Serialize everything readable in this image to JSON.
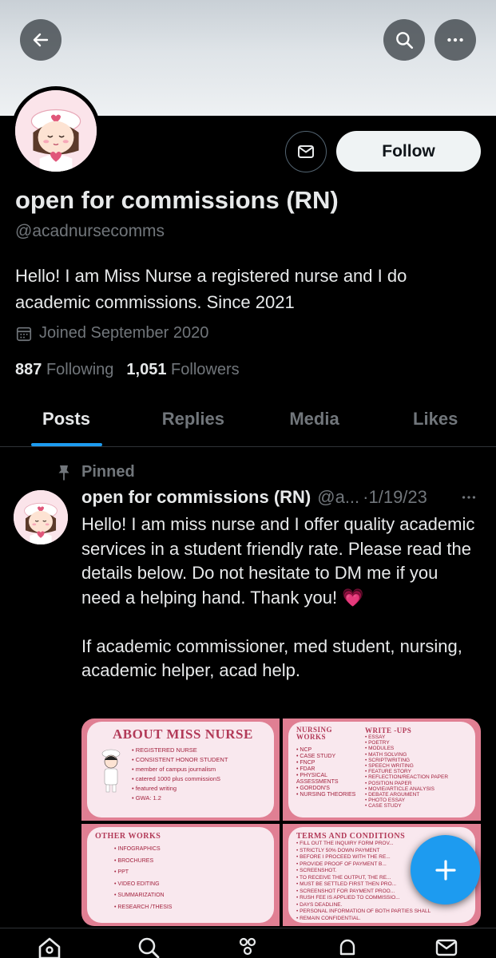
{
  "profile": {
    "display_name": "open for commissions (RN)",
    "handle": "@acadnursecomms",
    "bio": "Hello! I am Miss Nurse a registered nurse and I do academic commissions. Since 2021",
    "joined": "Joined September 2020",
    "following_count": "887",
    "following_label": "Following",
    "followers_count": "1,051",
    "followers_label": "Followers",
    "follow_label": "Follow"
  },
  "tabs": [
    {
      "label": "Posts",
      "active": true
    },
    {
      "label": "Replies",
      "active": false
    },
    {
      "label": "Media",
      "active": false
    },
    {
      "label": "Likes",
      "active": false
    }
  ],
  "pinned_post": {
    "pinned_label": "Pinned",
    "author": "open for commissions (RN)",
    "handle": "@a...",
    "date": "·1/19/23",
    "text": "Hello! I am miss nurse and I offer quality academic services in a student friendly rate. Please read the details below. Do not hesitate to DM me if you need a helping hand. Thank you! 💗\n\nIf academic commissioner, med student, nursing, academic helper, acad help.",
    "media": {
      "about": {
        "title": "ABOUT MISS NURSE",
        "items": [
          "REGISTERED NURSE",
          "CONSISTENT HONOR STUDENT",
          "member of campus journalism",
          "catered 1000 plus commissionS",
          "featured writing",
          "GWA: 1.2"
        ]
      },
      "nursing": {
        "title": "NURSING WORKS",
        "items": [
          "NCP",
          "CASE STUDY",
          "FNCP",
          "FDAR",
          "PHYSICAL ASSESSMENTS",
          "GORDON'S",
          "NURSING THEORIES"
        ]
      },
      "writeups": {
        "title": "WRITE -UPS",
        "items": [
          "ESSAY",
          "POETRY",
          "MODULES",
          "MATH SOLVING",
          "SCRIPTWRITING",
          "SPEECH WRITING",
          "FEATURE STORY",
          "REFLECTION/REACTION PAPER",
          "POSITION PAPER",
          "MOVIE/ARTICLE ANALYSIS",
          "DEBATE ARGUMENT",
          "PHOTO ESSAY",
          "CASE STUDY"
        ]
      },
      "other": {
        "title": "OTHER WORKS",
        "items": [
          "INFOGRAPHICS",
          "BROCHURES",
          "PPT",
          "VIDEO EDITING",
          "SUMMARIZATION",
          "RESEARCH /THESIS"
        ]
      },
      "terms": {
        "title": "TERMS AND CONDITIONS",
        "items": [
          "FILL OUT THE INQUIRY FORM PROV...",
          "STRICTLY 50% DOWN PAYMENT",
          "BEFORE I PROCEED WITH THE RE...",
          "PROVIDE PROOF OF PAYMENT B...",
          "SCREENSHOT.",
          "TO RECEIVE THE OUTPUT, THE RE...",
          "MUST BE SETTLED FIRST THEN PRO...",
          "SCREENSHOT FOR PAYMENT PROO...",
          "RUSH FEE IS APPLIED TO COMMISSIO...",
          "DAYS DEADLINE.",
          "PERSONAL INFORMATION OF BOTH PARTIES SHALL",
          "REMAIN CONFIDENTIAL."
        ]
      }
    }
  },
  "icons": {
    "back": "arrow-left-icon",
    "search": "search-icon",
    "more": "more-icon",
    "message": "envelope-icon",
    "calendar": "calendar-icon",
    "pin": "pin-icon",
    "compose": "plus-icon"
  },
  "colors": {
    "accent": "#1d9bf0",
    "background": "#000000",
    "muted": "#71767b",
    "card_pink": "#e07f93"
  }
}
